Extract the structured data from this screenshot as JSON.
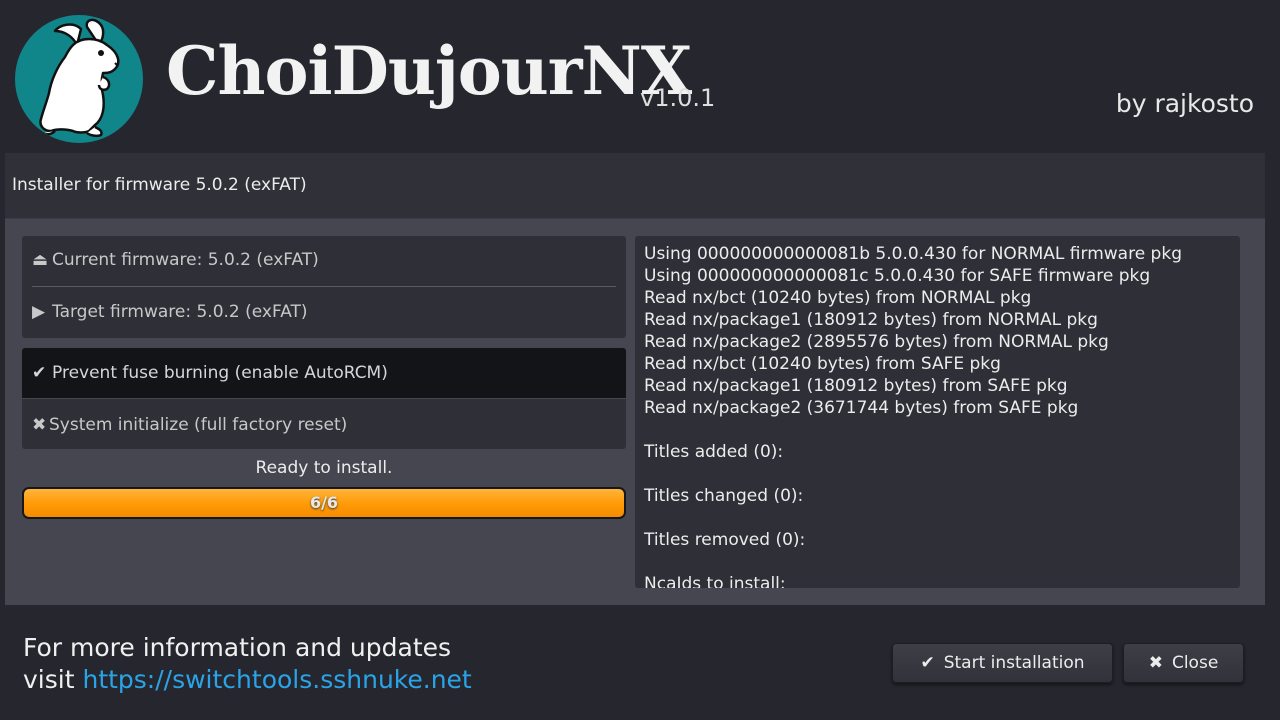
{
  "header": {
    "app_title": "ChoiDujourNX",
    "version": "v1.0.1",
    "author": "by rajkosto"
  },
  "panel": {
    "header_text": "Installer for firmware 5.0.2 (exFAT)",
    "current_firmware": "Current firmware: 5.0.2 (exFAT)",
    "target_firmware": "Target firmware: 5.0.2 (exFAT)",
    "options": [
      {
        "label": "Prevent fuse burning (enable AutoRCM)",
        "icon": "check-icon",
        "selected": true
      },
      {
        "label": "System initialize (full factory reset)",
        "icon": "x-icon",
        "selected": false
      }
    ],
    "status": "Ready to install.",
    "progress": {
      "label": "6/6",
      "fraction": 1.0
    }
  },
  "log": {
    "lines": [
      "Using 000000000000081b 5.0.0.430 for NORMAL firmware pkg",
      "Using 000000000000081c 5.0.0.430 for SAFE firmware pkg",
      "Read nx/bct (10240 bytes) from NORMAL pkg",
      "Read nx/package1 (180912 bytes) from NORMAL pkg",
      "Read nx/package2 (2895576 bytes) from NORMAL pkg",
      "Read nx/bct (10240 bytes) from SAFE pkg",
      "Read nx/package1 (180912 bytes) from SAFE pkg",
      "Read nx/package2 (3671744 bytes) from SAFE pkg",
      "",
      "Titles added (0):",
      "",
      "Titles changed (0):",
      "",
      "Titles removed (0):",
      "",
      "NcaIds to install:"
    ]
  },
  "footer": {
    "line1": "For more information and updates",
    "visit": "visit",
    "link": "https://switchtools.sshnuke.net",
    "start_button": "Start installation",
    "close_button": "Close"
  },
  "colors": {
    "background": "#26272e",
    "logo_circle": "#10868a",
    "progress_orange": "#ff9a06",
    "link_blue": "#2aa4e8"
  }
}
